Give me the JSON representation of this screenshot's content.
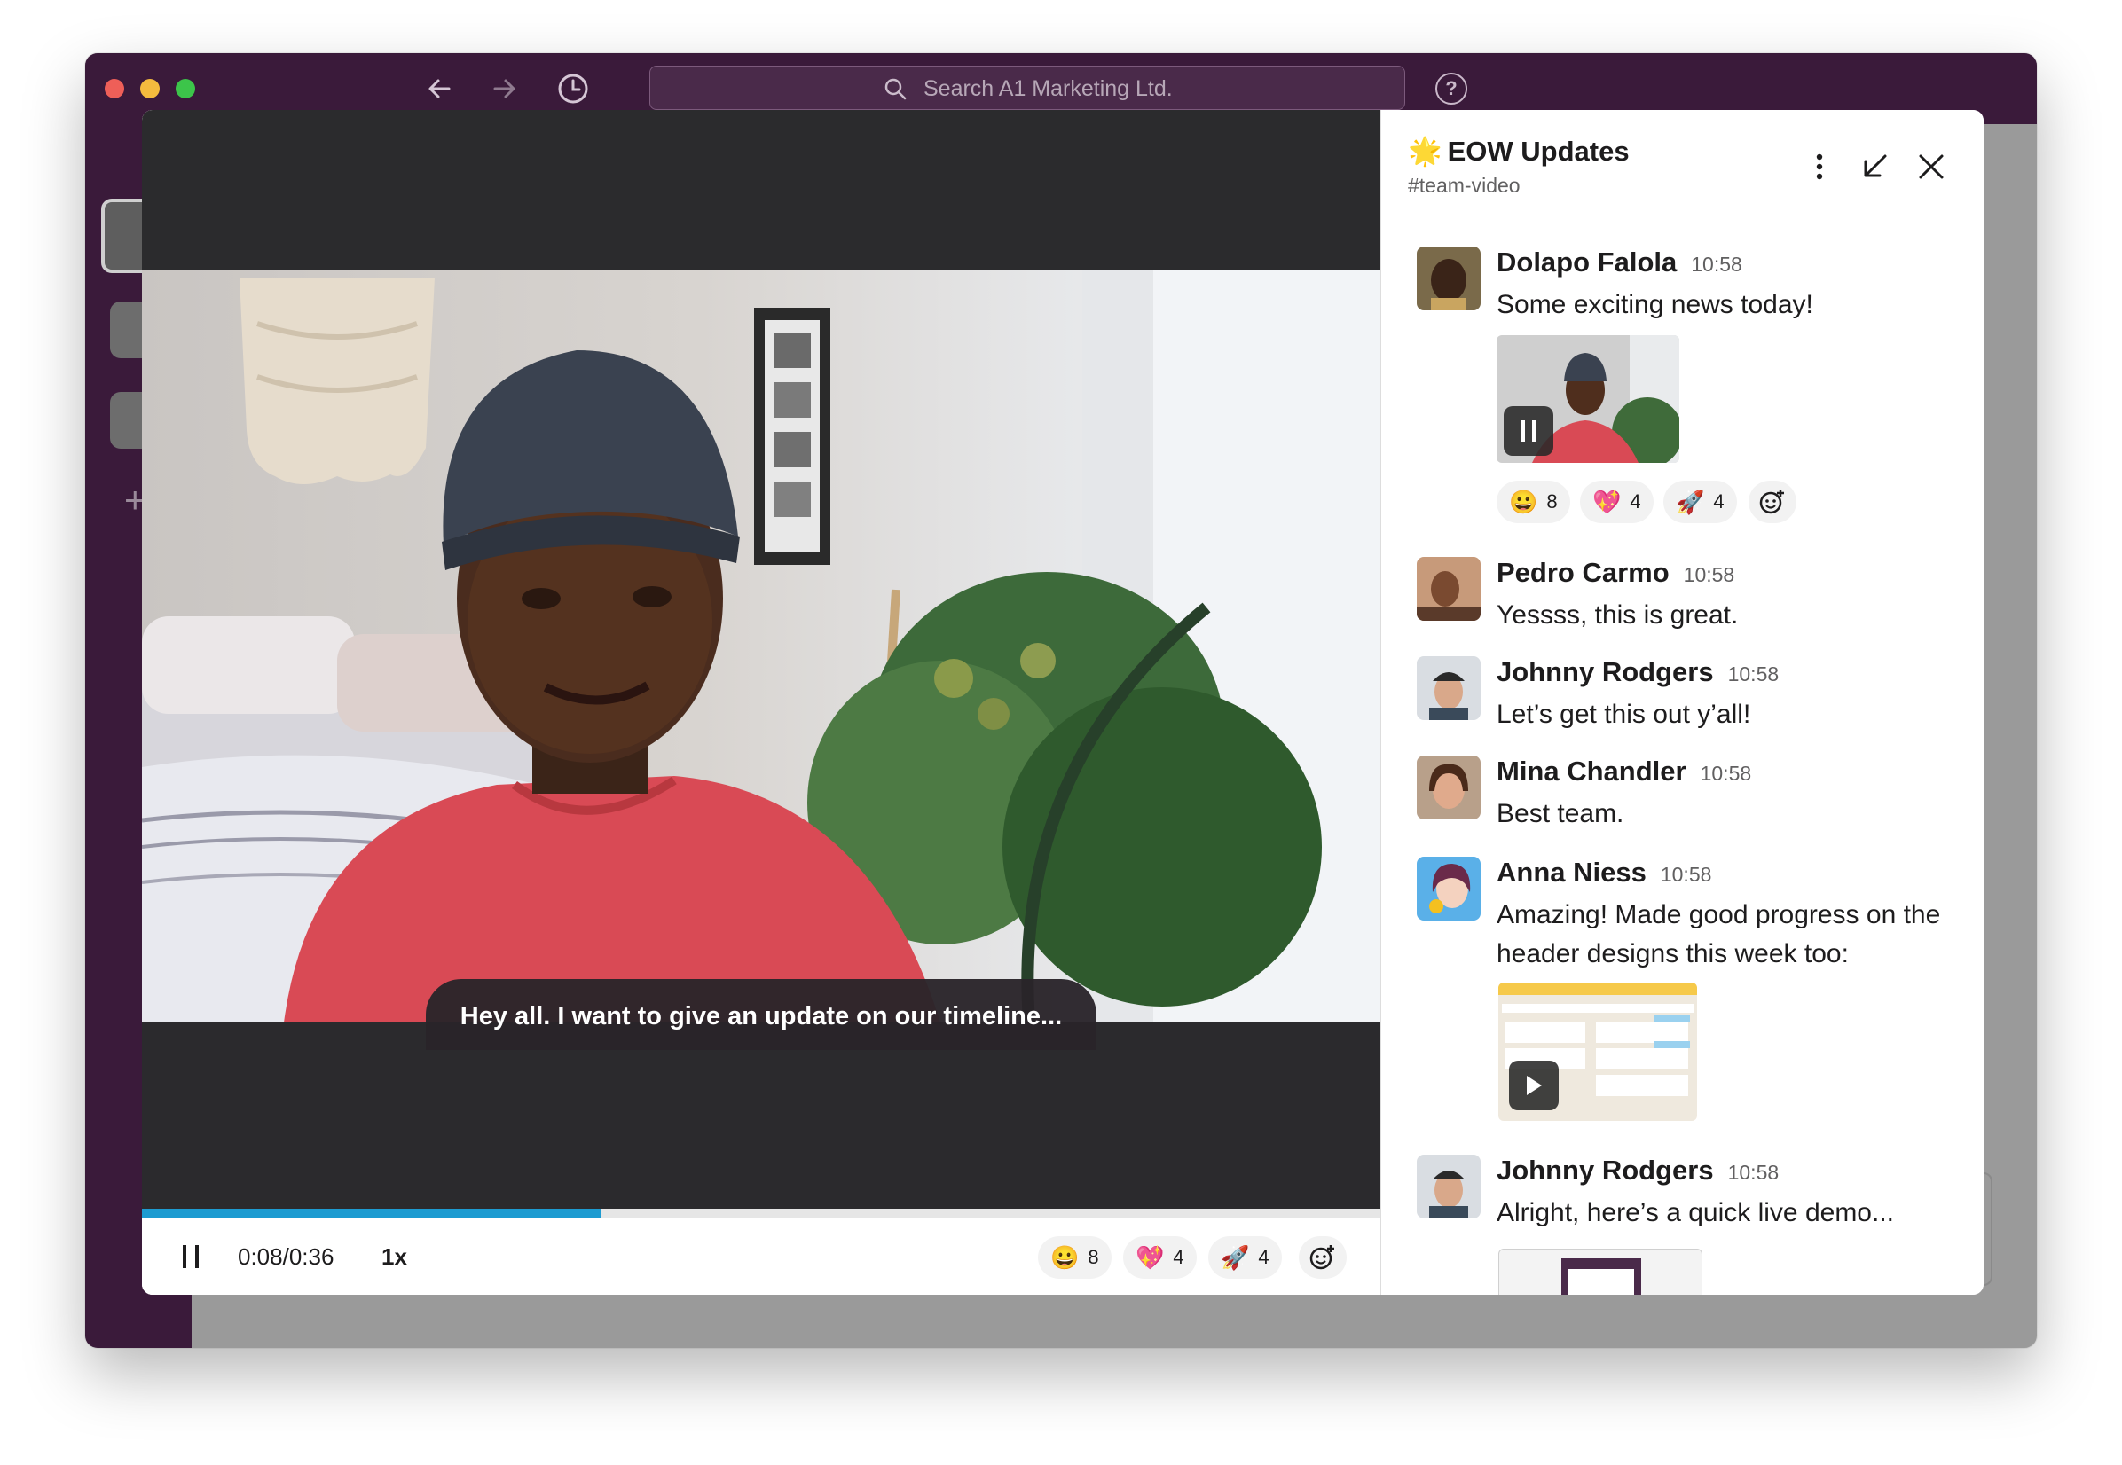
{
  "search": {
    "placeholder": "Search A1 Marketing Ltd."
  },
  "titlebar": {
    "back_icon": "arrow-left-icon",
    "forward_icon": "arrow-right-icon",
    "history_icon": "clock-icon",
    "help_icon": "help-icon",
    "help_label": "?"
  },
  "rail": {
    "add_label": "+"
  },
  "player": {
    "caption": "Hey all. I want to give an update on our timeline...",
    "time": "0:08/0:36",
    "speed": "1x",
    "progress": 0.37,
    "reactions": [
      {
        "emoji": "😀",
        "count": "8"
      },
      {
        "emoji": "💖",
        "count": "4"
      },
      {
        "emoji": "🚀",
        "count": "4"
      }
    ]
  },
  "panel": {
    "title_emoji": "🌟",
    "title": "EOW Updates",
    "channel": "#team-video",
    "messages": [
      {
        "name": "Dolapo Falola",
        "time": "10:58",
        "text": "Some exciting news today!"
      },
      {
        "name": "Pedro Carmo",
        "time": "10:58",
        "text": "Yessss, this is great."
      },
      {
        "name": "Johnny Rodgers",
        "time": "10:58",
        "text": "Let’s get this out y’all!"
      },
      {
        "name": "Mina Chandler",
        "time": "10:58",
        "text": "Best team."
      },
      {
        "name": "Anna Niess",
        "time": "10:58",
        "text": "Amazing! Made good progress on the header designs this week too:"
      },
      {
        "name": "Johnny Rodgers",
        "time": "10:58",
        "text": "Alright, here’s a quick live demo..."
      }
    ],
    "reactions": [
      {
        "emoji": "😀",
        "count": "8"
      },
      {
        "emoji": "💖",
        "count": "4"
      },
      {
        "emoji": "🚀",
        "count": "4"
      }
    ]
  },
  "colors": {
    "aubergine": "#3a1a3a",
    "progress": "#1d9bd1",
    "text": "#1d1c1d",
    "muted": "#616061"
  }
}
